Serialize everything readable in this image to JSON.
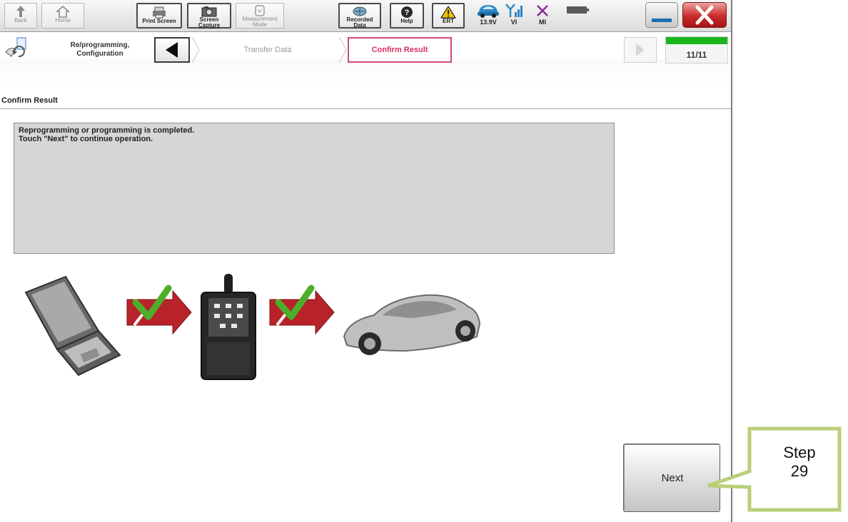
{
  "toolbar": {
    "back": "Back",
    "home": "Home",
    "print_screen": "Print Screen",
    "screen_capture": [
      "Screen",
      "Capture"
    ],
    "measurement_mode": [
      "Measurement",
      "Mode"
    ],
    "recorded_data": [
      "Recorded",
      "Data"
    ],
    "help": "Help",
    "ert": "ERT",
    "battery_voltage": "13.9V",
    "vi": "VI",
    "mi": "MI"
  },
  "nav": {
    "reprog_label": [
      "Re/programming,",
      "Configuration"
    ],
    "step_transfer": "Transfer Data",
    "step_confirm": "Confirm Result",
    "progress_text": "11/11",
    "progress_fraction": 1.0
  },
  "content": {
    "section_title": "Confirm Result",
    "message": [
      "Reprogramming or programming is completed.",
      "Touch \"Next\" to continue operation."
    ],
    "next_label": "Next"
  },
  "callout": {
    "line1": "Step",
    "line2": "29",
    "border_color": "#b9cf7a"
  },
  "colors": {
    "confirm_accent": "#d8305e",
    "progress_green": "#19b51d",
    "arrow_red": "#b8232a",
    "check_green": "#4caf2a",
    "close_red": "#c92b2b"
  }
}
